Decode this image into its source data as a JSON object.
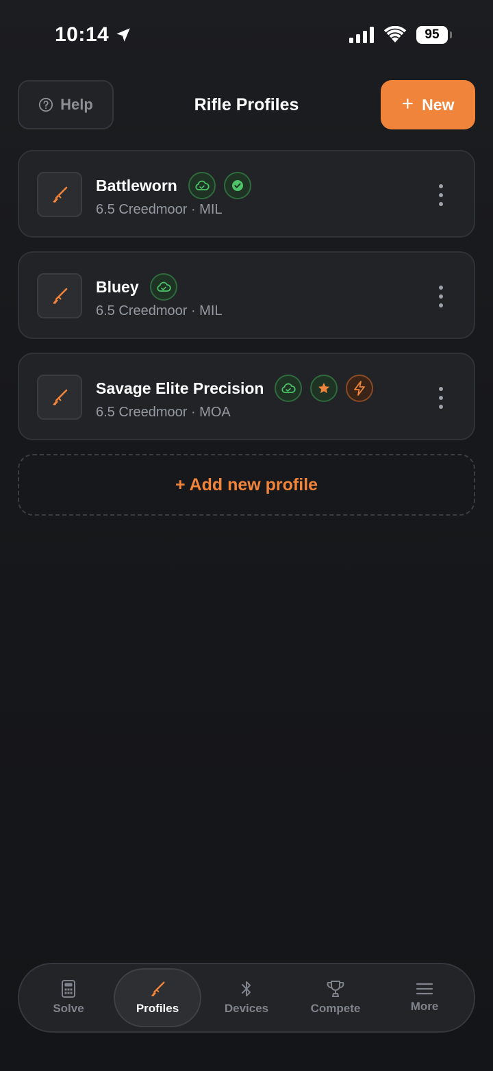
{
  "status_bar": {
    "time": "10:14",
    "battery": "95"
  },
  "header": {
    "help_label": "Help",
    "title": "Rifle Profiles",
    "new_label": "New"
  },
  "profiles": [
    {
      "name": "Battleworn",
      "subtitle": "6.5 Creedmoor · MIL",
      "badges": [
        "cloud-icon",
        "check-circle-icon"
      ]
    },
    {
      "name": "Bluey",
      "subtitle": "6.5 Creedmoor · MIL",
      "badges": [
        "cloud-icon"
      ]
    },
    {
      "name": "Savage Elite Precision",
      "subtitle": "6.5 Creedmoor · MOA",
      "badges": [
        "cloud-icon",
        "star-icon",
        "lightning-icon"
      ]
    }
  ],
  "add_profile_label": "+ Add new profile",
  "tabs": [
    {
      "label": "Solve",
      "icon": "calculator-icon",
      "active": false
    },
    {
      "label": "Profiles",
      "icon": "rifle-icon",
      "active": true
    },
    {
      "label": "Devices",
      "icon": "bluetooth-icon",
      "active": false
    },
    {
      "label": "Compete",
      "icon": "trophy-icon",
      "active": false
    },
    {
      "label": "More",
      "icon": "menu-icon",
      "active": false
    }
  ],
  "colors": {
    "accent": "#f0843a",
    "success": "#4cc467",
    "background": "#16171a",
    "card": "#222327"
  }
}
